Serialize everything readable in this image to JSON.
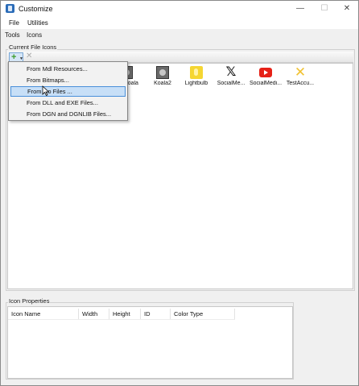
{
  "window": {
    "title": "Customize",
    "controls": {
      "minimize": "—",
      "maximize": "☐",
      "close": "✕"
    }
  },
  "menubar": {
    "items": [
      {
        "label": "File"
      },
      {
        "label": "Utilities"
      }
    ]
  },
  "tabs": [
    {
      "label": "Tools",
      "active": false
    },
    {
      "label": "Icons",
      "active": true
    }
  ],
  "current_icons": {
    "group_label": "Current File Icons",
    "toolbar": {
      "add_icon": "plus-icon",
      "delete_icon": "delete-x-icon"
    },
    "icons": [
      {
        "label": "Koala",
        "icon": "photo-icon"
      },
      {
        "label": "Koala2",
        "icon": "photo-icon"
      },
      {
        "label": "Lightbulb",
        "icon": "lightbulb-icon"
      },
      {
        "label": "SocialMe...",
        "icon": "x-logo-icon"
      },
      {
        "label": "SocialMedi...",
        "icon": "youtube-icon"
      },
      {
        "label": "TestAccu...",
        "icon": "yellow-x-icon"
      }
    ]
  },
  "dropdown": {
    "items": [
      {
        "label": "From Mdl Resources...",
        "highlighted": false
      },
      {
        "label": "From Bitmaps...",
        "highlighted": false
      },
      {
        "label": "From Ico Files ...",
        "highlighted": true
      },
      {
        "label": "From DLL and EXE Files...",
        "highlighted": false
      },
      {
        "label": "From DGN and DGNLIB Files...",
        "highlighted": false
      }
    ]
  },
  "icon_properties": {
    "group_label": "Icon Properties",
    "columns": [
      "Icon Name",
      "Width",
      "Height",
      "ID",
      "Color Type"
    ],
    "rows": []
  },
  "colors": {
    "highlight_bg": "#c7dff7",
    "highlight_border": "#4a90d9",
    "window_bg": "#f0f0f0"
  }
}
